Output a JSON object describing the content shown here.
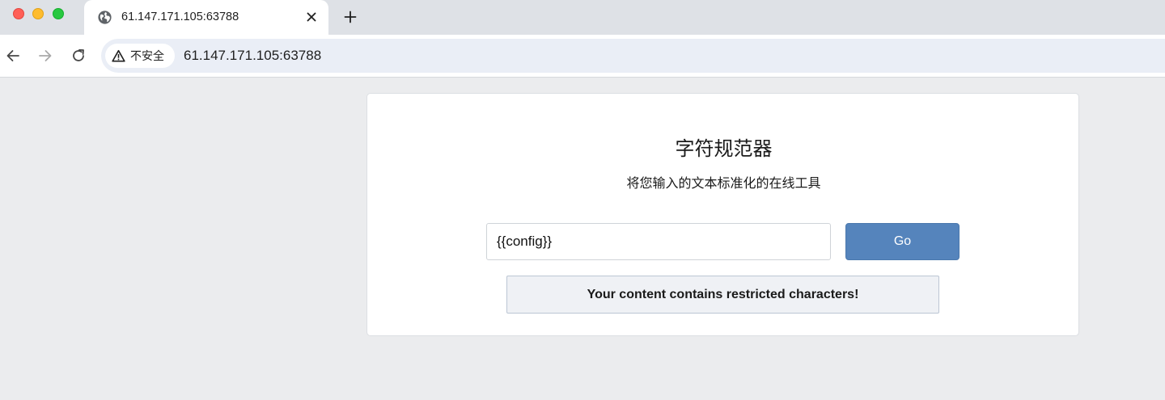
{
  "browser": {
    "tab": {
      "title": "61.147.171.105:63788",
      "icon": "globe-icon"
    },
    "toolbar": {
      "security_label": "不安全",
      "url": "61.147.171.105:63788"
    }
  },
  "page": {
    "title": "字符规范器",
    "subtitle": "将您输入的文本标准化的在线工具",
    "input": {
      "value": "{{config}}",
      "placeholder": ""
    },
    "go_label": "Go",
    "alert": "Your content contains restricted characters!"
  },
  "colors": {
    "accent_button": "#5584bc",
    "page_background": "#ebecee",
    "alert_background": "#eff1f5"
  }
}
